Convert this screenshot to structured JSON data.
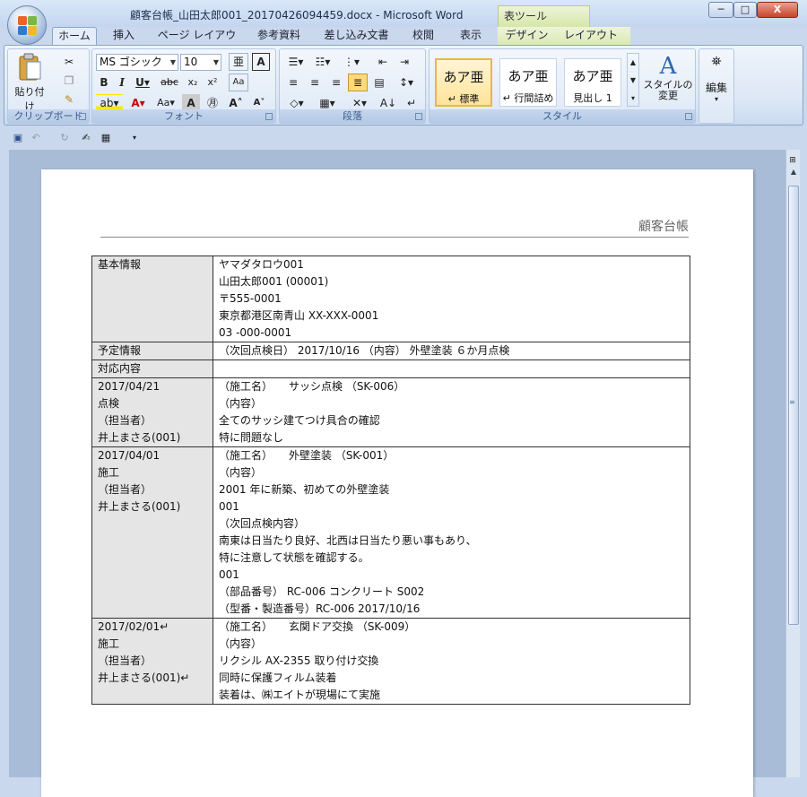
{
  "window": {
    "title": "顧客台帳_山田太郎001_20170426094459.docx - Microsoft Word",
    "contextual_group": "表ツール",
    "minimize": "─",
    "maximize": "□",
    "close": "X"
  },
  "tabs": [
    {
      "label": "ホーム",
      "active": true
    },
    {
      "label": "挿入"
    },
    {
      "label": "ページ レイアウト"
    },
    {
      "label": "参考資料"
    },
    {
      "label": "差し込み文書"
    },
    {
      "label": "校閲"
    },
    {
      "label": "表示"
    },
    {
      "label": "デザイン"
    },
    {
      "label": "レイアウト"
    }
  ],
  "ribbon": {
    "clipboard": {
      "label": "クリップボード",
      "paste": "貼り付け"
    },
    "font": {
      "label": "フォント",
      "font_name": "MS ゴシック",
      "font_size": "10"
    },
    "paragraph": {
      "label": "段落"
    },
    "styles": {
      "label": "スタイル",
      "items": [
        {
          "sample": "あア亜",
          "name": "↵ 標準",
          "selected": true
        },
        {
          "sample": "あア亜",
          "name": "↵ 行間詰め"
        },
        {
          "sample": "あア亜",
          "name": "見出し 1"
        }
      ],
      "change_styles": "スタイルの\n変更"
    },
    "editing": {
      "label": "編集"
    }
  },
  "document": {
    "header": "顧客台帳",
    "rows": [
      {
        "key": [
          "基本情報"
        ],
        "value": [
          "ヤマダタロウ001",
          "山田太郎001 (00001)",
          "〒555-0001",
          "東京都港区南青山 XX-XXX-0001",
          "03 -000-0001"
        ]
      },
      {
        "key": [
          "予定情報"
        ],
        "value": [
          "（次回点検日） 2017/10/16 （内容） 外壁塗装 ６か月点検"
        ]
      },
      {
        "key": [
          "対応内容"
        ],
        "value": [
          ""
        ]
      },
      {
        "key": [
          "2017/04/21",
          "点検",
          "（担当者）",
          "井上まさる(001)"
        ],
        "value": [
          "（施工名）　　サッシ点検 （SK-006）",
          "（内容）",
          "全てのサッシ建てつけ具合の確認",
          "特に問題なし"
        ]
      },
      {
        "key": [
          "2017/04/01",
          "施工",
          "（担当者）",
          "井上まさる(001)"
        ],
        "value": [
          "（施工名）　　外壁塗装 （SK-001）",
          "（内容）",
          "2001 年に新築、初めての外壁塗装",
          "001",
          "（次回点検内容）",
          "南東は日当たり良好、北西は日当たり悪い事もあり、",
          "特に注意して状態を確認する。",
          "001",
          "（部品番号） RC-006 コンクリート S002",
          "（型番・製造番号）RC-006 2017/10/16"
        ]
      },
      {
        "key": [
          "2017/02/01↵",
          "施工",
          "（担当者）",
          "井上まさる(001)↵"
        ],
        "value": [
          "（施工名）　　玄関ドア交換 （SK-009）",
          "（内容）",
          "リクシル AX-2355 取り付け交換",
          "同時に保護フィルム装着",
          "装着は、㈱エイトが現場にて実施"
        ]
      }
    ]
  }
}
